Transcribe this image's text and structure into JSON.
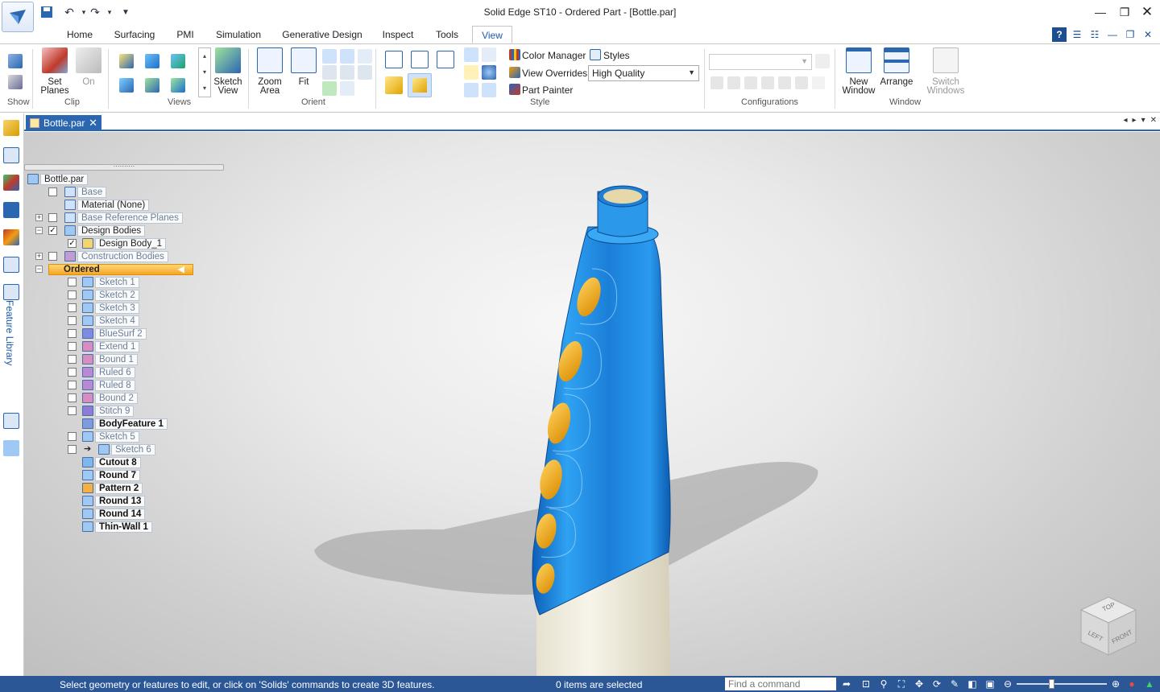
{
  "window": {
    "title": "Solid Edge ST10 - Ordered Part - [Bottle.par]"
  },
  "ribbon_tabs": [
    {
      "label": "Home"
    },
    {
      "label": "Surfacing"
    },
    {
      "label": "PMI"
    },
    {
      "label": "Simulation"
    },
    {
      "label": "Generative Design"
    },
    {
      "label": "Inspect"
    },
    {
      "label": "Tools"
    },
    {
      "label": "View",
      "active": true
    }
  ],
  "ribbon": {
    "show_label": "Show",
    "clip_label": "Clip",
    "set_planes": "Set Planes",
    "on": "On",
    "views_label": "Views",
    "sketch_view": "Sketch View",
    "zoom_area": "Zoom Area",
    "fit": "Fit",
    "orient_label": "Orient",
    "color_manager": "Color Manager",
    "styles": "Styles",
    "view_overrides": "View Overrides",
    "quality_value": "High Quality",
    "part_painter": "Part Painter",
    "style_label": "Style",
    "configurations_label": "Configurations",
    "new_window": "New Window",
    "arrange": "Arrange",
    "switch_windows": "Switch Windows",
    "window_label": "Window"
  },
  "document_tab": {
    "label": "Bottle.par"
  },
  "feature_library_label": "Feature Library",
  "tree": [
    {
      "label": "Bottle.par",
      "style": "normal"
    },
    {
      "label": "Base",
      "style": "dim",
      "checked": false
    },
    {
      "label": "Material (None)",
      "style": "normal"
    },
    {
      "label": "Base Reference Planes",
      "style": "dim",
      "checked": false,
      "expander": "+"
    },
    {
      "label": "Design Bodies",
      "style": "normal",
      "checked": true,
      "expander": "−"
    },
    {
      "label": "Design Body_1",
      "style": "normal",
      "checked": true
    },
    {
      "label": "Construction Bodies",
      "style": "dim",
      "checked": false,
      "expander": "+"
    },
    {
      "label": "Ordered",
      "style": "ordered",
      "expander": "−"
    },
    {
      "label": "Sketch 1",
      "style": "dim",
      "checked": false
    },
    {
      "label": "Sketch 2",
      "style": "dim",
      "checked": false
    },
    {
      "label": "Sketch 3",
      "style": "dim",
      "checked": false
    },
    {
      "label": "Sketch 4",
      "style": "dim",
      "checked": false
    },
    {
      "label": "BlueSurf 2",
      "style": "dim",
      "checked": false
    },
    {
      "label": "Extend 1",
      "style": "dim",
      "checked": false
    },
    {
      "label": "Bound 1",
      "style": "dim",
      "checked": false
    },
    {
      "label": "Ruled 6",
      "style": "dim",
      "checked": false
    },
    {
      "label": "Ruled 8",
      "style": "dim",
      "checked": false
    },
    {
      "label": "Bound 2",
      "style": "dim",
      "checked": false
    },
    {
      "label": "Stitch 9",
      "style": "dim",
      "checked": false
    },
    {
      "label": "BodyFeature 1",
      "style": "bold"
    },
    {
      "label": "Sketch 5",
      "style": "dim",
      "checked": false
    },
    {
      "label": "Sketch 6",
      "style": "dim",
      "checked": false
    },
    {
      "label": "Cutout 8",
      "style": "bold"
    },
    {
      "label": "Round 7",
      "style": "bold"
    },
    {
      "label": "Pattern 2",
      "style": "bold"
    },
    {
      "label": "Round 13",
      "style": "bold"
    },
    {
      "label": "Round 14",
      "style": "bold"
    },
    {
      "label": "Thin-Wall 1",
      "style": "bold"
    }
  ],
  "viewcube": {
    "top": "TOP",
    "left": "LEFT",
    "front": "FRONT"
  },
  "status": {
    "message": "Select geometry or features to edit, or click on 'Solids' commands to create 3D features.",
    "selection": "0 items are selected",
    "find_placeholder": "Find a command"
  },
  "colors": {
    "accent": "#2b66b1",
    "statusbar": "#2b5797",
    "bottle_blue": "#1f8ee0",
    "window_gold": "#f0a81c"
  }
}
